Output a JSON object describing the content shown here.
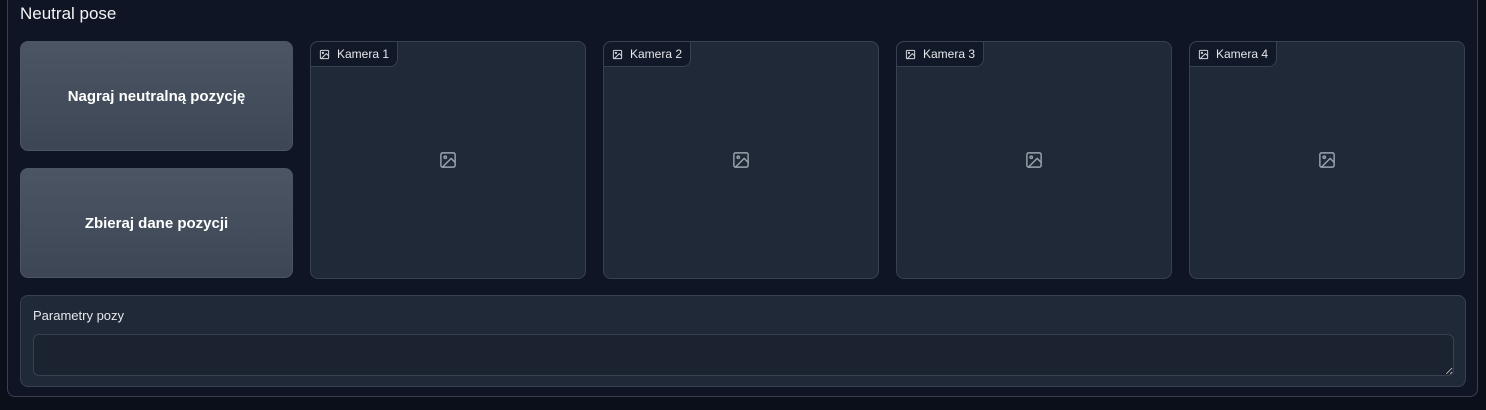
{
  "section": {
    "title": "Neutral pose"
  },
  "actions": {
    "record_label": "Nagraj neutralną pozycję",
    "collect_label": "Zbieraj dane pozycji"
  },
  "cameras": [
    {
      "label": "Kamera 1",
      "icon": "image-icon"
    },
    {
      "label": "Kamera 2",
      "icon": "image-icon"
    },
    {
      "label": "Kamera 3",
      "icon": "image-icon"
    },
    {
      "label": "Kamera 4",
      "icon": "image-icon"
    }
  ],
  "params": {
    "label": "Parametry pozy",
    "value": "",
    "placeholder": ""
  },
  "colors": {
    "background": "#0b0f19",
    "panel": "#1f2937",
    "border": "#374151",
    "button": "#4b5563"
  }
}
